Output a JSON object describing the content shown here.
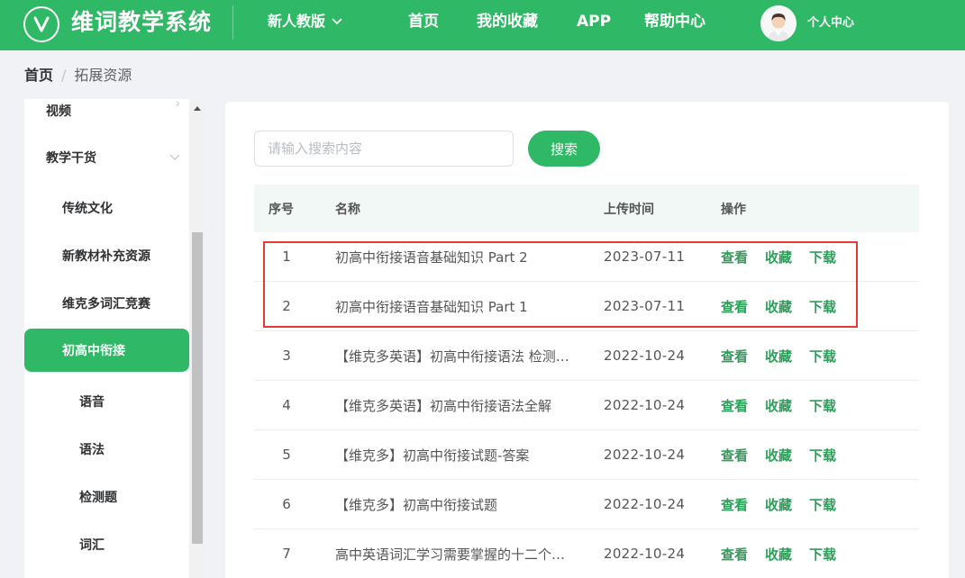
{
  "header": {
    "brand": "维词教学系统",
    "edition": "新人教版",
    "nav": [
      {
        "label": "首页"
      },
      {
        "label": "我的收藏"
      },
      {
        "label": "APP"
      },
      {
        "label": "帮助中心"
      }
    ],
    "user_center": "个人中心",
    "colors": {
      "brand": "#2fb865",
      "highlight": "#e53935"
    }
  },
  "breadcrumb": {
    "home": "首页",
    "separator": "/",
    "current": "拓展资源"
  },
  "sidebar": {
    "items": [
      {
        "label": "视频",
        "arrow": "chevron-right-icon"
      },
      {
        "label": "教学干货",
        "arrow": "chevron-down-icon"
      },
      {
        "label": "传统文化"
      },
      {
        "label": "新教材补充资源"
      },
      {
        "label": "维克多词汇竞赛"
      },
      {
        "label": "初高中衔接",
        "active": true
      },
      {
        "label": "语音"
      },
      {
        "label": "语法"
      },
      {
        "label": "检测题"
      },
      {
        "label": "词汇"
      }
    ]
  },
  "search": {
    "placeholder": "请输入搜索内容",
    "button": "搜索"
  },
  "table": {
    "headers": {
      "index": "序号",
      "name": "名称",
      "time": "上传时间",
      "ops": "操作"
    },
    "ops_labels": {
      "view": "查看",
      "collect": "收藏",
      "download": "下载"
    },
    "rows": [
      {
        "index": "1",
        "name": "初高中衔接语音基础知识 Part 2",
        "time": "2023-07-11"
      },
      {
        "index": "2",
        "name": "初高中衔接语音基础知识 Part 1",
        "time": "2023-07-11"
      },
      {
        "index": "3",
        "name": "【维克多英语】初高中衔接语法 检测…",
        "time": "2022-10-24"
      },
      {
        "index": "4",
        "name": "【维克多英语】初高中衔接语法全解",
        "time": "2022-10-24"
      },
      {
        "index": "5",
        "name": "【维克多】初高中衔接试题-答案",
        "time": "2022-10-24"
      },
      {
        "index": "6",
        "name": "【维克多】初高中衔接试题",
        "time": "2022-10-24"
      },
      {
        "index": "7",
        "name": "高中英语词汇学习需要掌握的十二个…",
        "time": "2022-10-24"
      }
    ]
  }
}
